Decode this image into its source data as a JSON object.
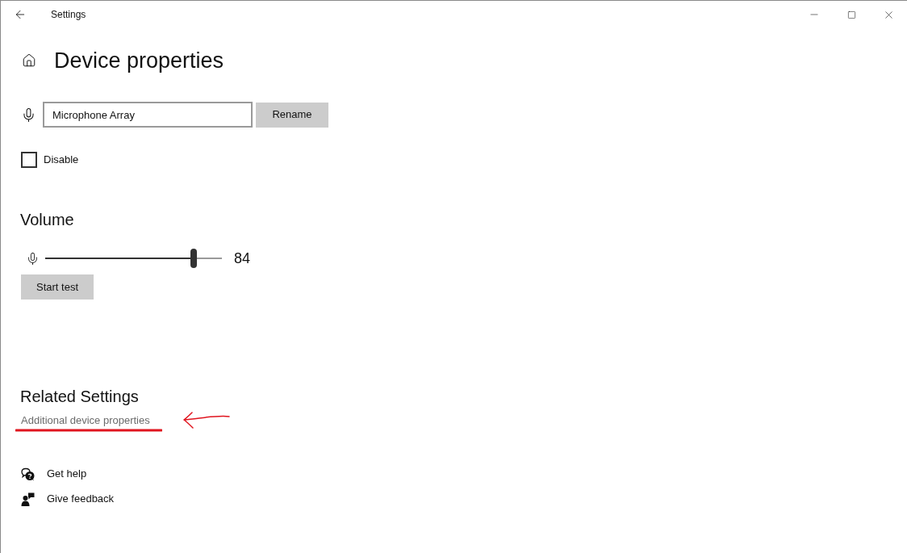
{
  "window": {
    "title": "Settings"
  },
  "page": {
    "title": "Device properties"
  },
  "device_name": {
    "value": "Microphone Array",
    "button": "Rename"
  },
  "disable": {
    "label": "Disable",
    "checked": false
  },
  "volume": {
    "heading": "Volume",
    "level": 0.84,
    "reading": "84",
    "button": "Start test"
  },
  "related_settings": {
    "heading": "Related Settings",
    "links": [
      "Additional device properties"
    ]
  },
  "help_links": [
    {
      "kind": "help",
      "label": "Get help"
    },
    {
      "kind": "feedback",
      "label": "Give feedback"
    }
  ]
}
